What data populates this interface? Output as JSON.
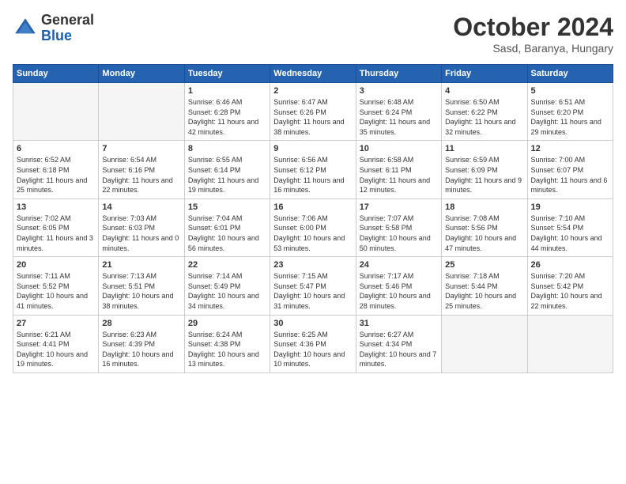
{
  "header": {
    "logo_general": "General",
    "logo_blue": "Blue",
    "month": "October 2024",
    "location": "Sasd, Baranya, Hungary"
  },
  "weekdays": [
    "Sunday",
    "Monday",
    "Tuesday",
    "Wednesday",
    "Thursday",
    "Friday",
    "Saturday"
  ],
  "weeks": [
    [
      {
        "day": "",
        "info": ""
      },
      {
        "day": "",
        "info": ""
      },
      {
        "day": "1",
        "info": "Sunrise: 6:46 AM\nSunset: 6:28 PM\nDaylight: 11 hours and 42 minutes."
      },
      {
        "day": "2",
        "info": "Sunrise: 6:47 AM\nSunset: 6:26 PM\nDaylight: 11 hours and 38 minutes."
      },
      {
        "day": "3",
        "info": "Sunrise: 6:48 AM\nSunset: 6:24 PM\nDaylight: 11 hours and 35 minutes."
      },
      {
        "day": "4",
        "info": "Sunrise: 6:50 AM\nSunset: 6:22 PM\nDaylight: 11 hours and 32 minutes."
      },
      {
        "day": "5",
        "info": "Sunrise: 6:51 AM\nSunset: 6:20 PM\nDaylight: 11 hours and 29 minutes."
      }
    ],
    [
      {
        "day": "6",
        "info": "Sunrise: 6:52 AM\nSunset: 6:18 PM\nDaylight: 11 hours and 25 minutes."
      },
      {
        "day": "7",
        "info": "Sunrise: 6:54 AM\nSunset: 6:16 PM\nDaylight: 11 hours and 22 minutes."
      },
      {
        "day": "8",
        "info": "Sunrise: 6:55 AM\nSunset: 6:14 PM\nDaylight: 11 hours and 19 minutes."
      },
      {
        "day": "9",
        "info": "Sunrise: 6:56 AM\nSunset: 6:12 PM\nDaylight: 11 hours and 16 minutes."
      },
      {
        "day": "10",
        "info": "Sunrise: 6:58 AM\nSunset: 6:11 PM\nDaylight: 11 hours and 12 minutes."
      },
      {
        "day": "11",
        "info": "Sunrise: 6:59 AM\nSunset: 6:09 PM\nDaylight: 11 hours and 9 minutes."
      },
      {
        "day": "12",
        "info": "Sunrise: 7:00 AM\nSunset: 6:07 PM\nDaylight: 11 hours and 6 minutes."
      }
    ],
    [
      {
        "day": "13",
        "info": "Sunrise: 7:02 AM\nSunset: 6:05 PM\nDaylight: 11 hours and 3 minutes."
      },
      {
        "day": "14",
        "info": "Sunrise: 7:03 AM\nSunset: 6:03 PM\nDaylight: 11 hours and 0 minutes."
      },
      {
        "day": "15",
        "info": "Sunrise: 7:04 AM\nSunset: 6:01 PM\nDaylight: 10 hours and 56 minutes."
      },
      {
        "day": "16",
        "info": "Sunrise: 7:06 AM\nSunset: 6:00 PM\nDaylight: 10 hours and 53 minutes."
      },
      {
        "day": "17",
        "info": "Sunrise: 7:07 AM\nSunset: 5:58 PM\nDaylight: 10 hours and 50 minutes."
      },
      {
        "day": "18",
        "info": "Sunrise: 7:08 AM\nSunset: 5:56 PM\nDaylight: 10 hours and 47 minutes."
      },
      {
        "day": "19",
        "info": "Sunrise: 7:10 AM\nSunset: 5:54 PM\nDaylight: 10 hours and 44 minutes."
      }
    ],
    [
      {
        "day": "20",
        "info": "Sunrise: 7:11 AM\nSunset: 5:52 PM\nDaylight: 10 hours and 41 minutes."
      },
      {
        "day": "21",
        "info": "Sunrise: 7:13 AM\nSunset: 5:51 PM\nDaylight: 10 hours and 38 minutes."
      },
      {
        "day": "22",
        "info": "Sunrise: 7:14 AM\nSunset: 5:49 PM\nDaylight: 10 hours and 34 minutes."
      },
      {
        "day": "23",
        "info": "Sunrise: 7:15 AM\nSunset: 5:47 PM\nDaylight: 10 hours and 31 minutes."
      },
      {
        "day": "24",
        "info": "Sunrise: 7:17 AM\nSunset: 5:46 PM\nDaylight: 10 hours and 28 minutes."
      },
      {
        "day": "25",
        "info": "Sunrise: 7:18 AM\nSunset: 5:44 PM\nDaylight: 10 hours and 25 minutes."
      },
      {
        "day": "26",
        "info": "Sunrise: 7:20 AM\nSunset: 5:42 PM\nDaylight: 10 hours and 22 minutes."
      }
    ],
    [
      {
        "day": "27",
        "info": "Sunrise: 6:21 AM\nSunset: 4:41 PM\nDaylight: 10 hours and 19 minutes."
      },
      {
        "day": "28",
        "info": "Sunrise: 6:23 AM\nSunset: 4:39 PM\nDaylight: 10 hours and 16 minutes."
      },
      {
        "day": "29",
        "info": "Sunrise: 6:24 AM\nSunset: 4:38 PM\nDaylight: 10 hours and 13 minutes."
      },
      {
        "day": "30",
        "info": "Sunrise: 6:25 AM\nSunset: 4:36 PM\nDaylight: 10 hours and 10 minutes."
      },
      {
        "day": "31",
        "info": "Sunrise: 6:27 AM\nSunset: 4:34 PM\nDaylight: 10 hours and 7 minutes."
      },
      {
        "day": "",
        "info": ""
      },
      {
        "day": "",
        "info": ""
      }
    ]
  ]
}
